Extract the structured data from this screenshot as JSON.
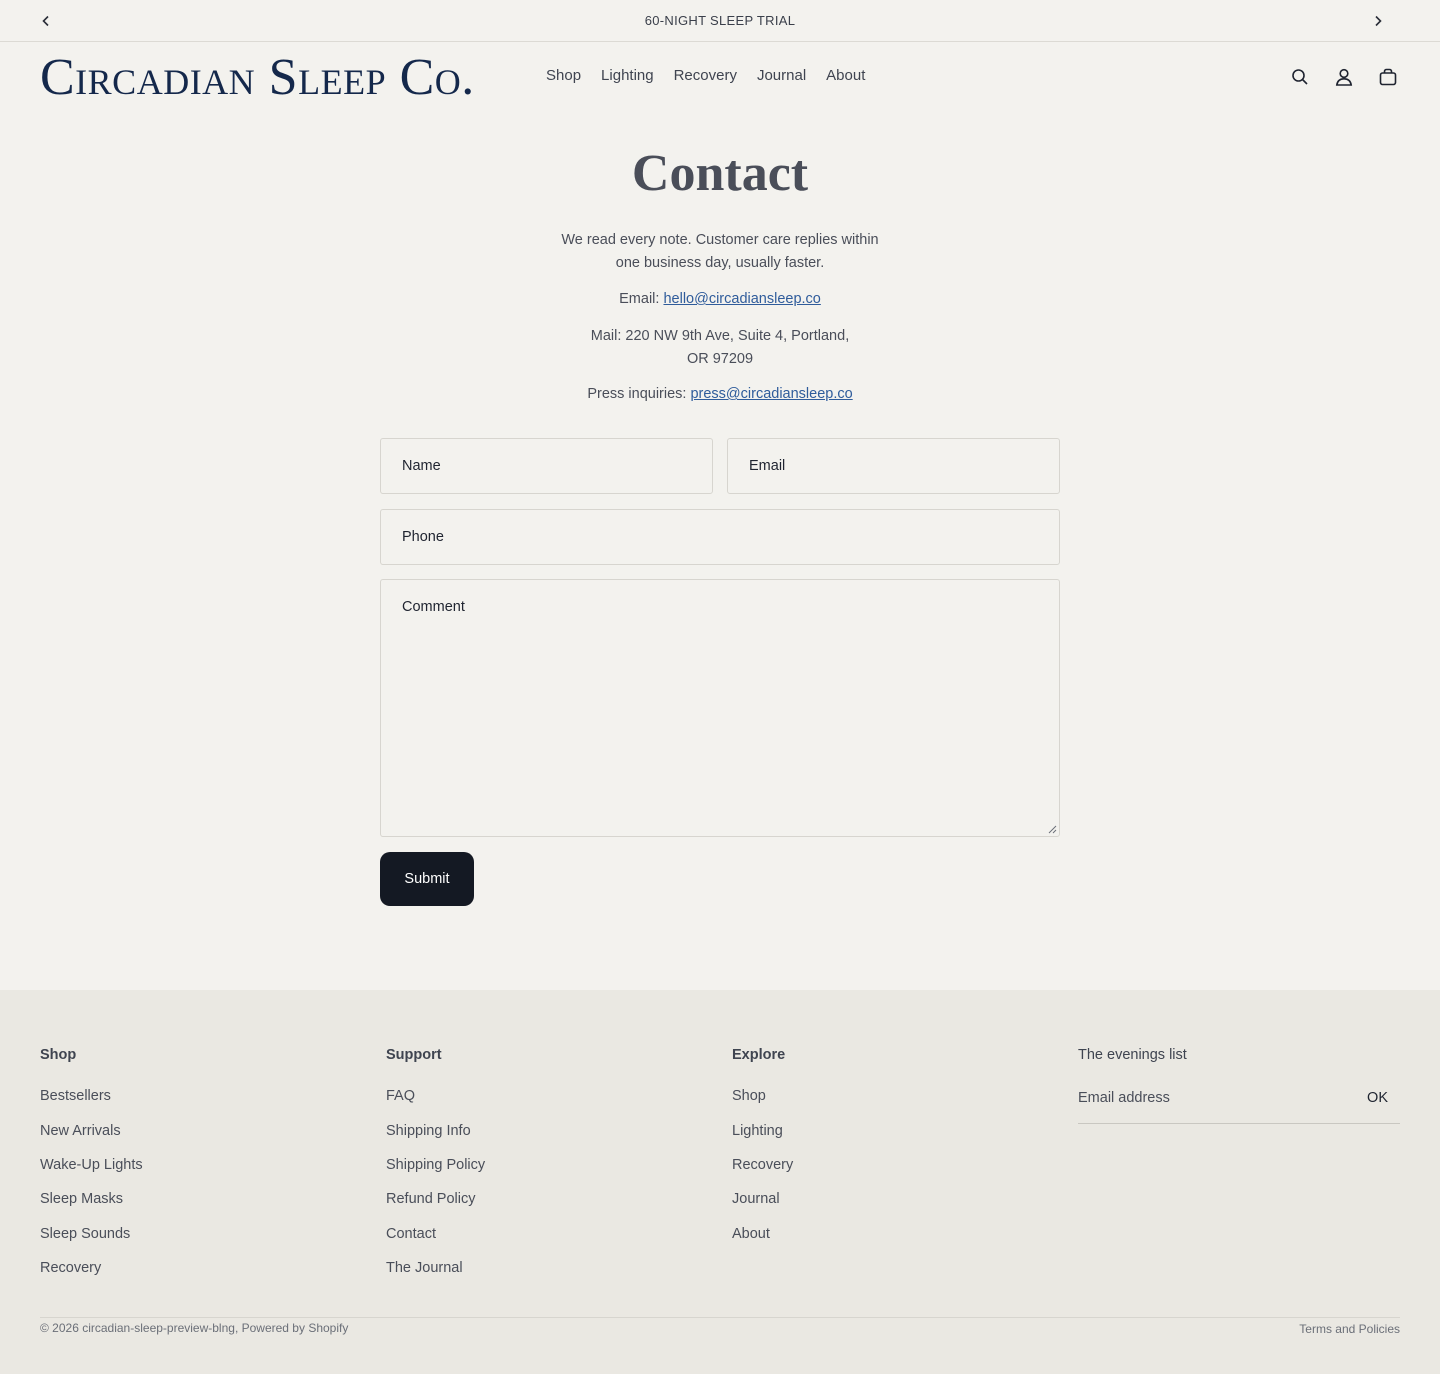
{
  "announcement": {
    "text": "60-NIGHT SLEEP TRIAL"
  },
  "header": {
    "logo": "Circadian Sleep Co.",
    "nav": [
      "Shop",
      "Lighting",
      "Recovery",
      "Journal",
      "About"
    ]
  },
  "main": {
    "title": "Contact",
    "intro": "We read every note. Customer care replies within one business day, usually faster.",
    "email_label": "Email: ",
    "email": "hello@circadiansleep.co",
    "mail_line1": "Mail: 220 NW 9th Ave, Suite 4, Portland,",
    "mail_line2": "OR 97209",
    "press_label": "Press inquiries: ",
    "press_email": "press@circadiansleep.co"
  },
  "form": {
    "name": "Name",
    "email": "Email",
    "phone": "Phone",
    "comment": "Comment",
    "submit": "Submit"
  },
  "footer": {
    "shop": {
      "title": "Shop",
      "items": [
        "Bestsellers",
        "New Arrivals",
        "Wake-Up Lights",
        "Sleep Masks",
        "Sleep Sounds",
        "Recovery"
      ]
    },
    "support": {
      "title": "Support",
      "items": [
        "FAQ",
        "Shipping Info",
        "Shipping Policy",
        "Refund Policy",
        "Contact",
        "The Journal"
      ]
    },
    "explore": {
      "title": "Explore",
      "items": [
        "Shop",
        "Lighting",
        "Recovery",
        "Journal",
        "About"
      ]
    },
    "newsletter": {
      "title": "The evenings list",
      "placeholder": "Email address",
      "ok": "OK"
    },
    "copyright": "© 2026 circadian-sleep-preview-blng, Powered by Shopify",
    "terms": "Terms and Policies"
  },
  "icons": [
    "chevron-left-icon",
    "chevron-right-icon",
    "search-icon",
    "user-icon",
    "bag-icon"
  ],
  "colors": {
    "background": "#f3f2ee",
    "footer": "#eae8e2",
    "logo": "#14284b",
    "link": "#2f5c9b",
    "button": "#141923"
  }
}
